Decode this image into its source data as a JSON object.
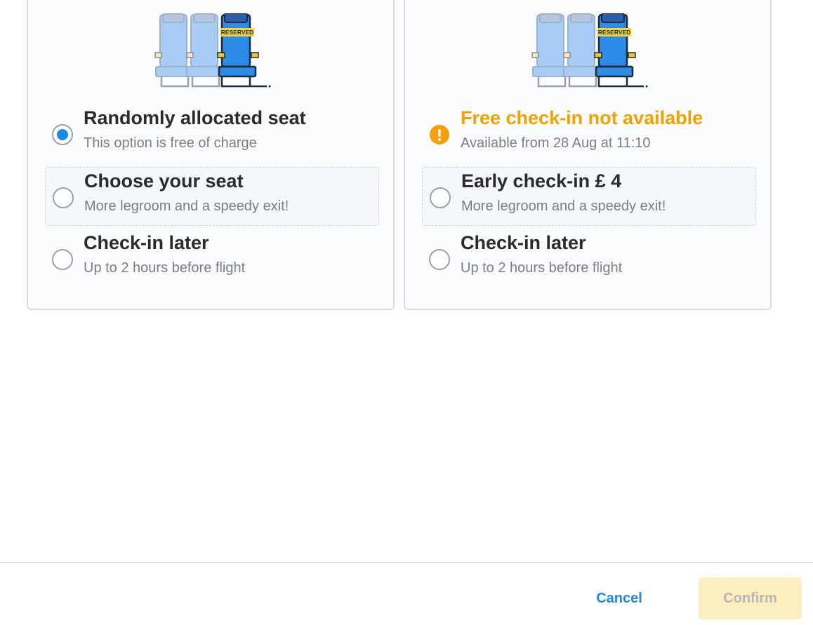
{
  "cards": [
    {
      "illustration": {
        "reserved_label": "RESERVED"
      },
      "options": [
        {
          "title": "Randomly allocated seat",
          "subtitle": "This option is free of charge",
          "state": "selected"
        },
        {
          "title": "Choose your seat",
          "subtitle": "More legroom and a speedy exit!",
          "state": "unselected"
        },
        {
          "title": "Check-in later",
          "subtitle": "Up to 2 hours before flight",
          "state": "unselected"
        }
      ]
    },
    {
      "illustration": {
        "reserved_label": "RESERVED"
      },
      "options": [
        {
          "title": "Free check-in not available",
          "subtitle": "Available from 28 Aug at 11:10",
          "state": "warning",
          "icon": "warning-icon"
        },
        {
          "title": "Early check-in £ 4",
          "subtitle": "More legroom and a speedy exit!",
          "state": "unselected"
        },
        {
          "title": "Check-in later",
          "subtitle": "Up to 2 hours before flight",
          "state": "unselected"
        }
      ]
    }
  ],
  "footer": {
    "cancel_label": "Cancel",
    "confirm_label": "Confirm"
  },
  "colors": {
    "accent": "#1e88e5",
    "warning": "#f2a100",
    "confirm_disabled_bg": "#fbefc0",
    "seat_light": "#a8ccf5",
    "seat_reserved": "#2e8be6"
  }
}
